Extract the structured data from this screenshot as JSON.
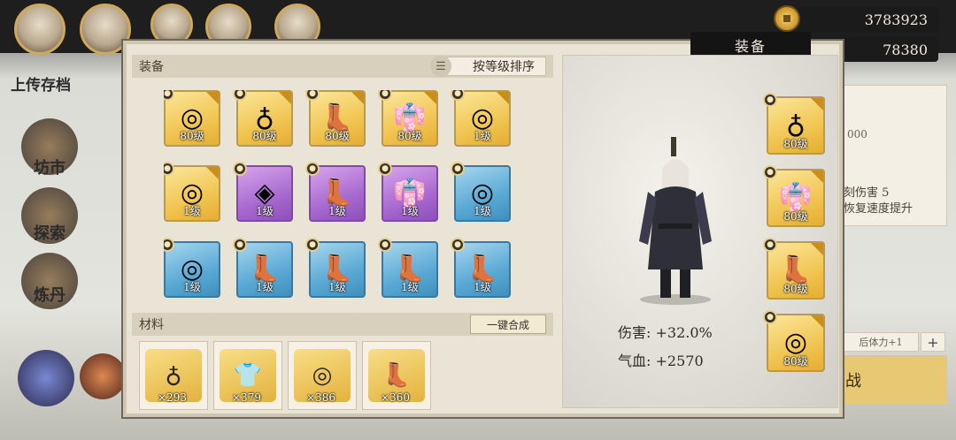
{
  "hud": {
    "save_label": "上传存档",
    "menu": [
      "坊市",
      "探索",
      "炼丹"
    ],
    "currencies": [
      {
        "icon": "coin-icon",
        "value": "3783923"
      },
      {
        "icon": "gem-icon",
        "value": "78380"
      }
    ],
    "side_texts": [
      "000",
      "刻伤害 5",
      "恢复速度提升"
    ],
    "side_power_label": "后体力+1",
    "side_plus": "+",
    "side_battle": "战"
  },
  "dialog": {
    "tab_label": "装备",
    "equipment_header": "装备",
    "sort_label": "按等级排序",
    "equipment": [
      {
        "type": "ring",
        "rarity": "gold",
        "glyph": "◎",
        "level": "80级"
      },
      {
        "type": "necklace",
        "rarity": "gold",
        "glyph": "♁",
        "level": "80级"
      },
      {
        "type": "boots",
        "rarity": "gold",
        "glyph": "👢",
        "level": "80级"
      },
      {
        "type": "armor",
        "rarity": "gold",
        "glyph": "👘",
        "level": "80级"
      },
      {
        "type": "ring",
        "rarity": "gold",
        "glyph": "◎",
        "level": "1级"
      },
      {
        "type": "ring",
        "rarity": "gold",
        "glyph": "◎",
        "level": "1级"
      },
      {
        "type": "necklace",
        "rarity": "purple",
        "glyph": "◈",
        "level": "1级"
      },
      {
        "type": "boots",
        "rarity": "purple",
        "glyph": "👢",
        "level": "1级"
      },
      {
        "type": "armor",
        "rarity": "purple",
        "glyph": "👘",
        "level": "1级"
      },
      {
        "type": "ring",
        "rarity": "blue",
        "glyph": "◎",
        "level": "1级"
      },
      {
        "type": "ring",
        "rarity": "blue",
        "glyph": "◎",
        "level": "1级"
      },
      {
        "type": "boots",
        "rarity": "blue",
        "glyph": "👢",
        "level": "1级"
      },
      {
        "type": "boots",
        "rarity": "blue",
        "glyph": "👢",
        "level": "1级"
      },
      {
        "type": "boots",
        "rarity": "blue",
        "glyph": "👢",
        "level": "1级"
      },
      {
        "type": "boots",
        "rarity": "blue",
        "glyph": "👢",
        "level": "1级"
      }
    ],
    "materials_header": "材料",
    "combine_label": "一键合成",
    "materials": [
      {
        "name": "necklace",
        "glyph": "♁",
        "count": "×293"
      },
      {
        "name": "armor",
        "glyph": "👕",
        "count": "×379"
      },
      {
        "name": "ring",
        "glyph": "◎",
        "count": "×386"
      },
      {
        "name": "boots",
        "glyph": "👢",
        "count": "×360"
      }
    ],
    "stats": [
      {
        "label": "伤害:",
        "value": "+32.0%"
      },
      {
        "label": "气血:",
        "value": "+2570"
      }
    ],
    "equipped_slots": [
      {
        "type": "necklace",
        "rarity": "gold",
        "glyph": "♁",
        "level": "80级"
      },
      {
        "type": "armor",
        "rarity": "gold",
        "glyph": "👘",
        "level": "80级"
      },
      {
        "type": "boots",
        "rarity": "gold",
        "glyph": "👢",
        "level": "80级"
      },
      {
        "type": "ring",
        "rarity": "gold",
        "glyph": "◎",
        "level": "80级"
      }
    ]
  }
}
